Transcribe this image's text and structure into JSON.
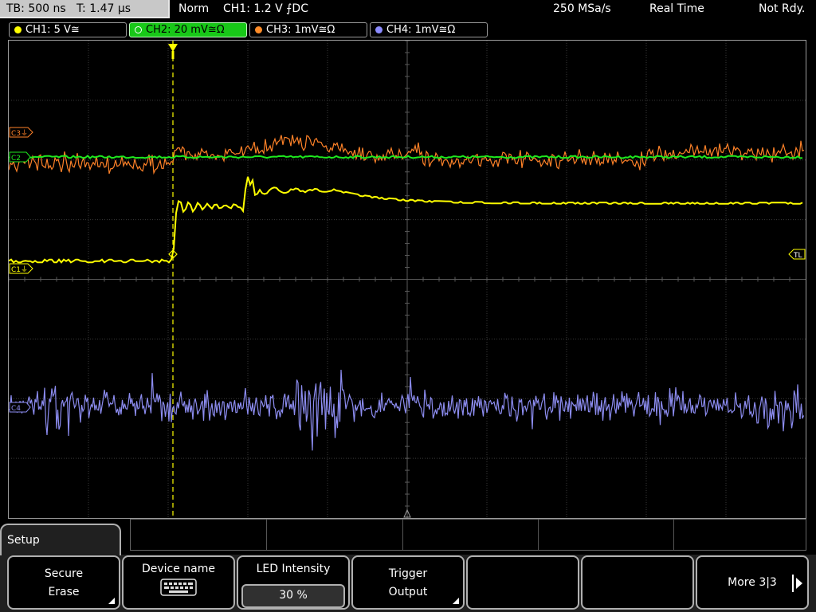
{
  "status": {
    "timebase": "TB: 500 ns",
    "trigger_time": "T: 1.47 µs",
    "mode": "Norm",
    "trigger_info": "CH1: 1.2 V ⨍DC",
    "sample_rate": "250 MSa/s",
    "acq_mode": "Real Time",
    "state": "Not Rdy."
  },
  "channels": [
    {
      "label": "CH1: 5 V≅",
      "color": "#ffff00"
    },
    {
      "label": "CH2: 20 mV≅Ω",
      "color": "#00ff00"
    },
    {
      "label": "CH3: 1mV≅Ω",
      "color": "#ff8c28"
    },
    {
      "label": "CH4: 1mV≅Ω",
      "color": "#8c8cff"
    }
  ],
  "markers": {
    "c3": "C3⏚",
    "c2": "C2",
    "c1": "C1⏚",
    "c4": "C4",
    "trigger_level": "TL"
  },
  "menu": {
    "title": "Setup",
    "softkeys": [
      {
        "line1": "Secure",
        "line2": "Erase"
      },
      {
        "line1": "Device name",
        "icon": "keyboard-icon"
      },
      {
        "line1": "LED Intensity",
        "value": "30 %"
      },
      {
        "line1": "Trigger",
        "line2": "Output"
      },
      {
        "line1": ""
      },
      {
        "line1": ""
      },
      {
        "line1": "More 3|3"
      }
    ]
  }
}
